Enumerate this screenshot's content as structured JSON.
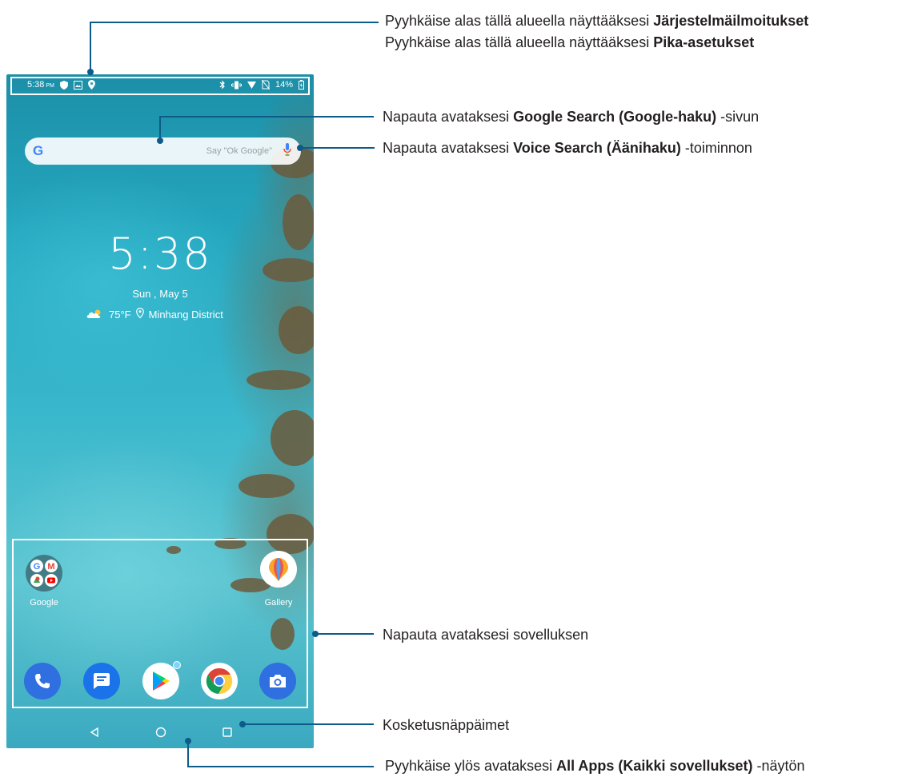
{
  "phone": {
    "status": {
      "time": "5:38",
      "ampm": "PM",
      "battery": "14%"
    },
    "search": {
      "logo": "G",
      "hint": "Say \"Ok Google\""
    },
    "clock": "5:38",
    "date": "Sun , May 5",
    "weather": {
      "temp": "75°F",
      "location": "Minhang District"
    },
    "apps": {
      "google_label": "Google",
      "gallery_label": "Gallery"
    },
    "dock": [
      "phone-icon",
      "messages-icon",
      "play-store-icon",
      "chrome-icon",
      "camera-icon"
    ]
  },
  "callouts": {
    "notifications": {
      "prefix": "Pyyhkäise alas tällä alueella näyttääksesi ",
      "bold": "Järjestelmäilmoitukset"
    },
    "quick_settings": {
      "prefix": "Pyyhkäise alas tällä alueella näyttääksesi ",
      "bold": "Pika-asetukset"
    },
    "google_search": {
      "prefix": "Napauta avataksesi ",
      "bold": "Google Search (Google-haku)",
      "suffix": " -sivun"
    },
    "voice_search": {
      "prefix": "Napauta avataksesi ",
      "bold": "Voice Search (Äänihaku)",
      "suffix": " -toiminnon"
    },
    "apps": {
      "text": "Napauta avataksesi sovelluksen"
    },
    "touch_keys": {
      "text": "Kosketusnäppäimet"
    },
    "all_apps": {
      "prefix": "Pyyhkäise ylös avataksesi ",
      "bold": "All Apps (Kaikki sovellukset)",
      "suffix": " -näytön"
    }
  },
  "colors": {
    "leader": "#0d5b89",
    "frame": "#ffffff"
  }
}
